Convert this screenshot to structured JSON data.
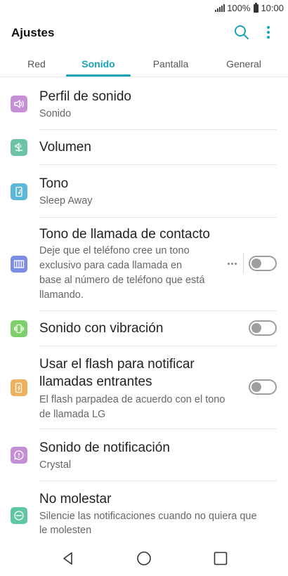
{
  "status_bar": {
    "battery_percent": "100%",
    "time": "10:00"
  },
  "header": {
    "title": "Ajustes"
  },
  "tabs": [
    {
      "label": "Red",
      "active": false
    },
    {
      "label": "Sonido",
      "active": true
    },
    {
      "label": "Pantalla",
      "active": false
    },
    {
      "label": "General",
      "active": false
    }
  ],
  "items": [
    {
      "title": "Perfil de sonido",
      "subtitle": "Sonido",
      "icon": "speaker-icon",
      "color": "#c58fd6"
    },
    {
      "title": "Volumen",
      "icon": "volume-icon",
      "color": "#6cc3a3"
    },
    {
      "title": "Tono",
      "subtitle": "Sleep Away",
      "icon": "phone-music-icon",
      "color": "#5db7d8"
    },
    {
      "title": "Tono de llamada de contacto",
      "subtitle_lines": [
        "Deje que el teléfono cree un tono",
        "exclusivo para cada llamada en",
        "base al número de teléfono que está",
        "llamando."
      ],
      "icon": "piano-icon",
      "color": "#7b8ee6",
      "toggle": false
    },
    {
      "title": "Sonido con vibración",
      "icon": "vibration-icon",
      "color": "#7fcf6b",
      "toggle": false
    },
    {
      "title_lines": [
        "Usar el flash para notificar",
        "llamadas entrantes"
      ],
      "subtitle_lines": [
        "El flash parpadea de acuerdo con el tono",
        "de llamada LG"
      ],
      "icon": "flash-phone-icon",
      "color": "#f0b15c",
      "toggle": false
    },
    {
      "title": "Sonido de notificación",
      "subtitle": "Crystal",
      "icon": "notification-icon",
      "color": "#c58fd6"
    },
    {
      "title": "No molestar",
      "subtitle_lines": [
        "Silencie las notificaciones cuando no quiera que",
        "le molesten"
      ],
      "icon": "do-not-disturb-icon",
      "color": "#5fc7a3"
    }
  ],
  "colors": {
    "accent": "#1aa3b7",
    "toggle_off": "#9e9e9e"
  }
}
